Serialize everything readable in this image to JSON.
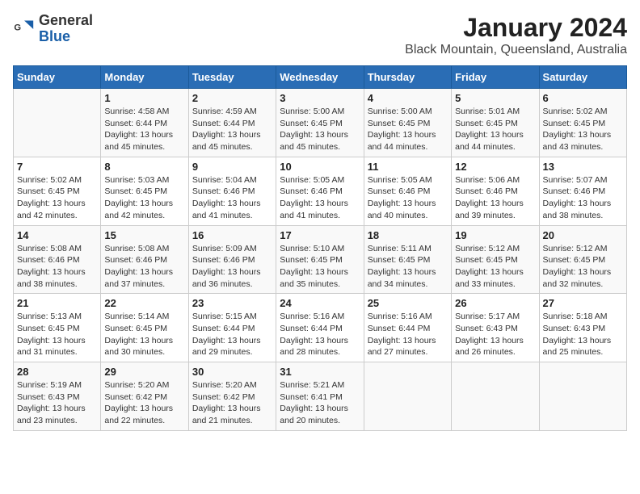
{
  "header": {
    "logo": {
      "general": "General",
      "blue": "Blue"
    },
    "month": "January 2024",
    "location": "Black Mountain, Queensland, Australia"
  },
  "weekdays": [
    "Sunday",
    "Monday",
    "Tuesday",
    "Wednesday",
    "Thursday",
    "Friday",
    "Saturday"
  ],
  "weeks": [
    [
      {
        "day": "",
        "info": ""
      },
      {
        "day": "1",
        "info": "Sunrise: 4:58 AM\nSunset: 6:44 PM\nDaylight: 13 hours\nand 45 minutes."
      },
      {
        "day": "2",
        "info": "Sunrise: 4:59 AM\nSunset: 6:44 PM\nDaylight: 13 hours\nand 45 minutes."
      },
      {
        "day": "3",
        "info": "Sunrise: 5:00 AM\nSunset: 6:45 PM\nDaylight: 13 hours\nand 45 minutes."
      },
      {
        "day": "4",
        "info": "Sunrise: 5:00 AM\nSunset: 6:45 PM\nDaylight: 13 hours\nand 44 minutes."
      },
      {
        "day": "5",
        "info": "Sunrise: 5:01 AM\nSunset: 6:45 PM\nDaylight: 13 hours\nand 44 minutes."
      },
      {
        "day": "6",
        "info": "Sunrise: 5:02 AM\nSunset: 6:45 PM\nDaylight: 13 hours\nand 43 minutes."
      }
    ],
    [
      {
        "day": "7",
        "info": "Sunrise: 5:02 AM\nSunset: 6:45 PM\nDaylight: 13 hours\nand 42 minutes."
      },
      {
        "day": "8",
        "info": "Sunrise: 5:03 AM\nSunset: 6:45 PM\nDaylight: 13 hours\nand 42 minutes."
      },
      {
        "day": "9",
        "info": "Sunrise: 5:04 AM\nSunset: 6:46 PM\nDaylight: 13 hours\nand 41 minutes."
      },
      {
        "day": "10",
        "info": "Sunrise: 5:05 AM\nSunset: 6:46 PM\nDaylight: 13 hours\nand 41 minutes."
      },
      {
        "day": "11",
        "info": "Sunrise: 5:05 AM\nSunset: 6:46 PM\nDaylight: 13 hours\nand 40 minutes."
      },
      {
        "day": "12",
        "info": "Sunrise: 5:06 AM\nSunset: 6:46 PM\nDaylight: 13 hours\nand 39 minutes."
      },
      {
        "day": "13",
        "info": "Sunrise: 5:07 AM\nSunset: 6:46 PM\nDaylight: 13 hours\nand 38 minutes."
      }
    ],
    [
      {
        "day": "14",
        "info": "Sunrise: 5:08 AM\nSunset: 6:46 PM\nDaylight: 13 hours\nand 38 minutes."
      },
      {
        "day": "15",
        "info": "Sunrise: 5:08 AM\nSunset: 6:46 PM\nDaylight: 13 hours\nand 37 minutes."
      },
      {
        "day": "16",
        "info": "Sunrise: 5:09 AM\nSunset: 6:46 PM\nDaylight: 13 hours\nand 36 minutes."
      },
      {
        "day": "17",
        "info": "Sunrise: 5:10 AM\nSunset: 6:45 PM\nDaylight: 13 hours\nand 35 minutes."
      },
      {
        "day": "18",
        "info": "Sunrise: 5:11 AM\nSunset: 6:45 PM\nDaylight: 13 hours\nand 34 minutes."
      },
      {
        "day": "19",
        "info": "Sunrise: 5:12 AM\nSunset: 6:45 PM\nDaylight: 13 hours\nand 33 minutes."
      },
      {
        "day": "20",
        "info": "Sunrise: 5:12 AM\nSunset: 6:45 PM\nDaylight: 13 hours\nand 32 minutes."
      }
    ],
    [
      {
        "day": "21",
        "info": "Sunrise: 5:13 AM\nSunset: 6:45 PM\nDaylight: 13 hours\nand 31 minutes."
      },
      {
        "day": "22",
        "info": "Sunrise: 5:14 AM\nSunset: 6:45 PM\nDaylight: 13 hours\nand 30 minutes."
      },
      {
        "day": "23",
        "info": "Sunrise: 5:15 AM\nSunset: 6:44 PM\nDaylight: 13 hours\nand 29 minutes."
      },
      {
        "day": "24",
        "info": "Sunrise: 5:16 AM\nSunset: 6:44 PM\nDaylight: 13 hours\nand 28 minutes."
      },
      {
        "day": "25",
        "info": "Sunrise: 5:16 AM\nSunset: 6:44 PM\nDaylight: 13 hours\nand 27 minutes."
      },
      {
        "day": "26",
        "info": "Sunrise: 5:17 AM\nSunset: 6:43 PM\nDaylight: 13 hours\nand 26 minutes."
      },
      {
        "day": "27",
        "info": "Sunrise: 5:18 AM\nSunset: 6:43 PM\nDaylight: 13 hours\nand 25 minutes."
      }
    ],
    [
      {
        "day": "28",
        "info": "Sunrise: 5:19 AM\nSunset: 6:43 PM\nDaylight: 13 hours\nand 23 minutes."
      },
      {
        "day": "29",
        "info": "Sunrise: 5:20 AM\nSunset: 6:42 PM\nDaylight: 13 hours\nand 22 minutes."
      },
      {
        "day": "30",
        "info": "Sunrise: 5:20 AM\nSunset: 6:42 PM\nDaylight: 13 hours\nand 21 minutes."
      },
      {
        "day": "31",
        "info": "Sunrise: 5:21 AM\nSunset: 6:41 PM\nDaylight: 13 hours\nand 20 minutes."
      },
      {
        "day": "",
        "info": ""
      },
      {
        "day": "",
        "info": ""
      },
      {
        "day": "",
        "info": ""
      }
    ]
  ]
}
